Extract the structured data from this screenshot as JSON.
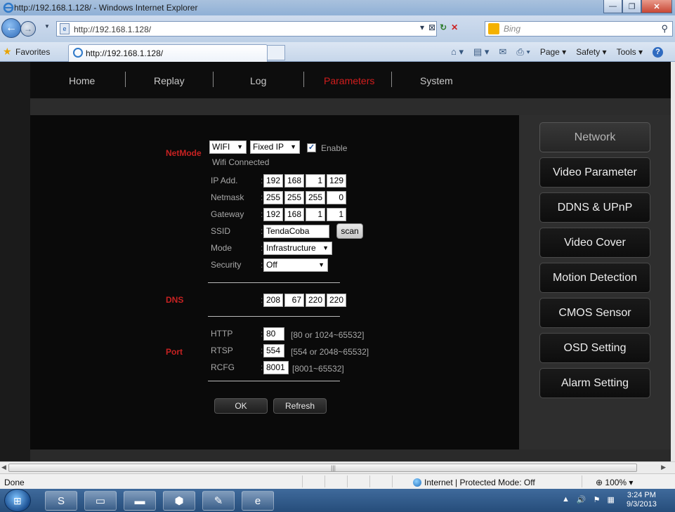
{
  "browser": {
    "title": "http://192.168.1.128/ - Windows Internet Explorer",
    "address": "http://192.168.1.128/",
    "search_placeholder": "Bing",
    "favorites_label": "Favorites",
    "tab_label": "http://192.168.1.128/",
    "commands": {
      "page": "Page ▾",
      "safety": "Safety ▾",
      "tools": "Tools ▾"
    },
    "status_text": "Done",
    "zone_text": "Internet | Protected Mode: Off",
    "zoom_text": "100%",
    "clock_time": "3:24 PM",
    "clock_date": "9/3/2013"
  },
  "nav": {
    "items": [
      "Home",
      "Replay",
      "Log",
      "Parameters",
      "System"
    ],
    "active": "Parameters"
  },
  "sidebar": {
    "items": [
      "Network",
      "Video Parameter",
      "DDNS & UPnP",
      "Video Cover",
      "Motion Detection",
      "CMOS Sensor",
      "OSD Setting",
      "Alarm Setting"
    ],
    "active": "Network"
  },
  "network": {
    "netmode_label": "NetMode",
    "mode_value": "WIFI",
    "ip_mode_value": "Fixed IP",
    "enable_label": "Enable",
    "enable_checked": true,
    "wifi_status": "Wifi Connected",
    "ip_label": "IP Add.",
    "ip": [
      "192",
      "168",
      "1",
      "129"
    ],
    "netmask_label": "Netmask",
    "netmask": [
      "255",
      "255",
      "255",
      "0"
    ],
    "gateway_label": "Gateway",
    "gateway": [
      "192",
      "168",
      "1",
      "1"
    ],
    "ssid_label": "SSID",
    "ssid_value": "TendaCoba",
    "scan_label": "scan",
    "mode_label": "Mode",
    "wifi_mode_value": "Infrastructure",
    "security_label": "Security",
    "security_value": "Off",
    "dns_label": "DNS",
    "dns": [
      "208",
      "67",
      "220",
      "220"
    ],
    "port_label": "Port",
    "http_label": "HTTP",
    "http_value": "80",
    "http_range": "[80 or 1024~65532]",
    "rtsp_label": "RTSP",
    "rtsp_value": "554",
    "rtsp_range": "[554 or 2048~65532]",
    "rcfg_label": "RCFG",
    "rcfg_value": "8001",
    "rcfg_range": "[8001~65532]",
    "ok_label": "OK",
    "refresh_label": "Refresh"
  },
  "colors": {
    "accent_red": "#d21d1d",
    "panel_bg": "#2e2e2e",
    "page_bg": "#0a0a0a"
  }
}
